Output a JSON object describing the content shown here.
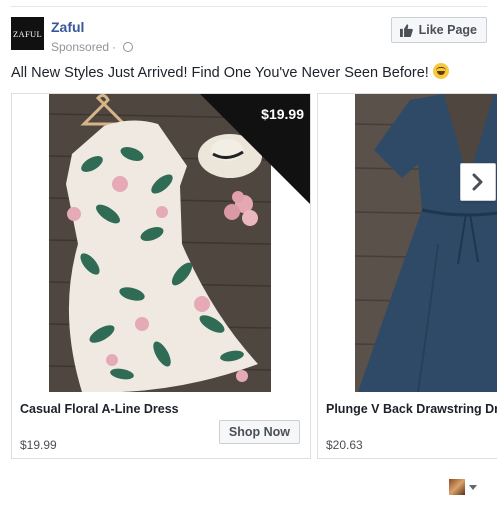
{
  "post": {
    "page_name": "Zaful",
    "logo_text": "ZAFUL",
    "sponsored": "Sponsored",
    "separator": "·",
    "like_button": "Like Page",
    "caption": "All New Styles Just Arrived! Find One You've Never Seen Before!"
  },
  "cards": [
    {
      "title": "Casual Floral A-Line Dress",
      "price": "$19.99",
      "badge": "$19.99",
      "cta": "Shop Now"
    },
    {
      "title": "Plunge V Back Drawstring Dress",
      "price": "$20.63"
    }
  ],
  "colors": {
    "link_blue": "#365899",
    "text": "#1d2129",
    "meta_gray": "#90949c",
    "button_bg": "#f6f7f9",
    "border": "#ccd0d5"
  },
  "icons": [
    "thumbs-up-icon",
    "globe-icon",
    "emoji-grin-icon",
    "chevron-right-icon",
    "caret-down-icon"
  ]
}
